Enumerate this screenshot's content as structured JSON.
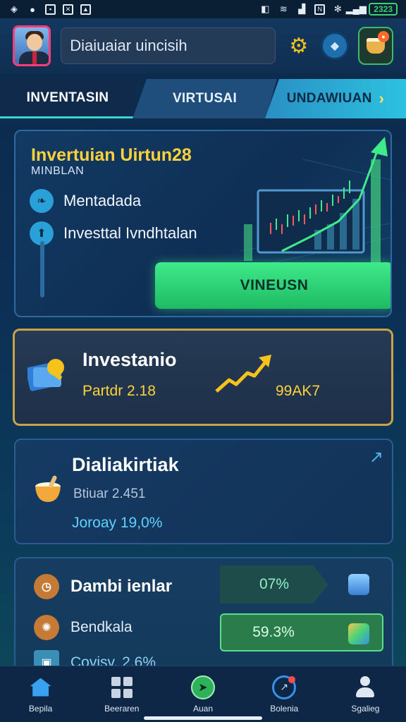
{
  "status_bar": {
    "battery": "2323"
  },
  "header": {
    "search_value": "Diaiuaiar uincisih"
  },
  "tabs": [
    {
      "label": "INVENTASIN"
    },
    {
      "label": "VIRTUSAI"
    },
    {
      "label": "UNDAWIUAN"
    }
  ],
  "hero": {
    "title": "Invertuian Uirtun28",
    "subtitle": "MINBLAN",
    "row1": "Mentadada",
    "row2": "Investtal Ivndhtalan",
    "cta": "VINEUSN"
  },
  "invest_card": {
    "title": "Investanio",
    "value": "Partdr 2.18",
    "right_value": "99AK7"
  },
  "card2": {
    "title": "Dialiakirtiak",
    "line1": "Btiuar 2.451",
    "line2": "Joroay 19,0%"
  },
  "card3": {
    "row1": "Dambi ienlar",
    "row2": "Bendkala",
    "row3": "Covisv. 2.6%",
    "pill1": "07%",
    "pill2": "59.3%"
  },
  "bottom_nav": [
    {
      "label": "Bepila"
    },
    {
      "label": "Beeraren"
    },
    {
      "label": "Auan"
    },
    {
      "label": "Bolenia"
    },
    {
      "label": "Sgalieg"
    }
  ],
  "colors": {
    "accent_green": "#3eea8a",
    "gold": "#ffd23c",
    "card_border_gold": "#c9a24a"
  }
}
